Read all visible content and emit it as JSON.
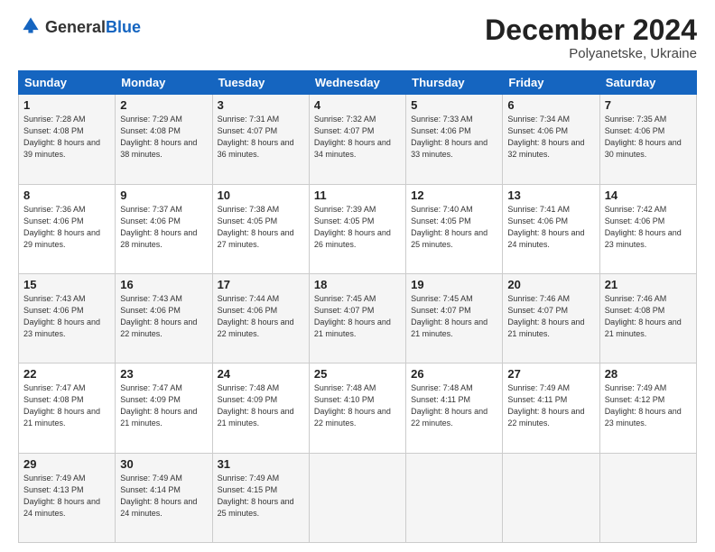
{
  "logo": {
    "general": "General",
    "blue": "Blue"
  },
  "header": {
    "month": "December 2024",
    "location": "Polyanetske, Ukraine"
  },
  "weekdays": [
    "Sunday",
    "Monday",
    "Tuesday",
    "Wednesday",
    "Thursday",
    "Friday",
    "Saturday"
  ],
  "weeks": [
    [
      {
        "day": "1",
        "sunrise": "7:28 AM",
        "sunset": "4:08 PM",
        "daylight": "8 hours and 39 minutes."
      },
      {
        "day": "2",
        "sunrise": "7:29 AM",
        "sunset": "4:08 PM",
        "daylight": "8 hours and 38 minutes."
      },
      {
        "day": "3",
        "sunrise": "7:31 AM",
        "sunset": "4:07 PM",
        "daylight": "8 hours and 36 minutes."
      },
      {
        "day": "4",
        "sunrise": "7:32 AM",
        "sunset": "4:07 PM",
        "daylight": "8 hours and 34 minutes."
      },
      {
        "day": "5",
        "sunrise": "7:33 AM",
        "sunset": "4:06 PM",
        "daylight": "8 hours and 33 minutes."
      },
      {
        "day": "6",
        "sunrise": "7:34 AM",
        "sunset": "4:06 PM",
        "daylight": "8 hours and 32 minutes."
      },
      {
        "day": "7",
        "sunrise": "7:35 AM",
        "sunset": "4:06 PM",
        "daylight": "8 hours and 30 minutes."
      }
    ],
    [
      {
        "day": "8",
        "sunrise": "7:36 AM",
        "sunset": "4:06 PM",
        "daylight": "8 hours and 29 minutes."
      },
      {
        "day": "9",
        "sunrise": "7:37 AM",
        "sunset": "4:06 PM",
        "daylight": "8 hours and 28 minutes."
      },
      {
        "day": "10",
        "sunrise": "7:38 AM",
        "sunset": "4:05 PM",
        "daylight": "8 hours and 27 minutes."
      },
      {
        "day": "11",
        "sunrise": "7:39 AM",
        "sunset": "4:05 PM",
        "daylight": "8 hours and 26 minutes."
      },
      {
        "day": "12",
        "sunrise": "7:40 AM",
        "sunset": "4:05 PM",
        "daylight": "8 hours and 25 minutes."
      },
      {
        "day": "13",
        "sunrise": "7:41 AM",
        "sunset": "4:06 PM",
        "daylight": "8 hours and 24 minutes."
      },
      {
        "day": "14",
        "sunrise": "7:42 AM",
        "sunset": "4:06 PM",
        "daylight": "8 hours and 23 minutes."
      }
    ],
    [
      {
        "day": "15",
        "sunrise": "7:43 AM",
        "sunset": "4:06 PM",
        "daylight": "8 hours and 23 minutes."
      },
      {
        "day": "16",
        "sunrise": "7:43 AM",
        "sunset": "4:06 PM",
        "daylight": "8 hours and 22 minutes."
      },
      {
        "day": "17",
        "sunrise": "7:44 AM",
        "sunset": "4:06 PM",
        "daylight": "8 hours and 22 minutes."
      },
      {
        "day": "18",
        "sunrise": "7:45 AM",
        "sunset": "4:07 PM",
        "daylight": "8 hours and 21 minutes."
      },
      {
        "day": "19",
        "sunrise": "7:45 AM",
        "sunset": "4:07 PM",
        "daylight": "8 hours and 21 minutes."
      },
      {
        "day": "20",
        "sunrise": "7:46 AM",
        "sunset": "4:07 PM",
        "daylight": "8 hours and 21 minutes."
      },
      {
        "day": "21",
        "sunrise": "7:46 AM",
        "sunset": "4:08 PM",
        "daylight": "8 hours and 21 minutes."
      }
    ],
    [
      {
        "day": "22",
        "sunrise": "7:47 AM",
        "sunset": "4:08 PM",
        "daylight": "8 hours and 21 minutes."
      },
      {
        "day": "23",
        "sunrise": "7:47 AM",
        "sunset": "4:09 PM",
        "daylight": "8 hours and 21 minutes."
      },
      {
        "day": "24",
        "sunrise": "7:48 AM",
        "sunset": "4:09 PM",
        "daylight": "8 hours and 21 minutes."
      },
      {
        "day": "25",
        "sunrise": "7:48 AM",
        "sunset": "4:10 PM",
        "daylight": "8 hours and 22 minutes."
      },
      {
        "day": "26",
        "sunrise": "7:48 AM",
        "sunset": "4:11 PM",
        "daylight": "8 hours and 22 minutes."
      },
      {
        "day": "27",
        "sunrise": "7:49 AM",
        "sunset": "4:11 PM",
        "daylight": "8 hours and 22 minutes."
      },
      {
        "day": "28",
        "sunrise": "7:49 AM",
        "sunset": "4:12 PM",
        "daylight": "8 hours and 23 minutes."
      }
    ],
    [
      {
        "day": "29",
        "sunrise": "7:49 AM",
        "sunset": "4:13 PM",
        "daylight": "8 hours and 24 minutes."
      },
      {
        "day": "30",
        "sunrise": "7:49 AM",
        "sunset": "4:14 PM",
        "daylight": "8 hours and 24 minutes."
      },
      {
        "day": "31",
        "sunrise": "7:49 AM",
        "sunset": "4:15 PM",
        "daylight": "8 hours and 25 minutes."
      },
      null,
      null,
      null,
      null
    ]
  ]
}
